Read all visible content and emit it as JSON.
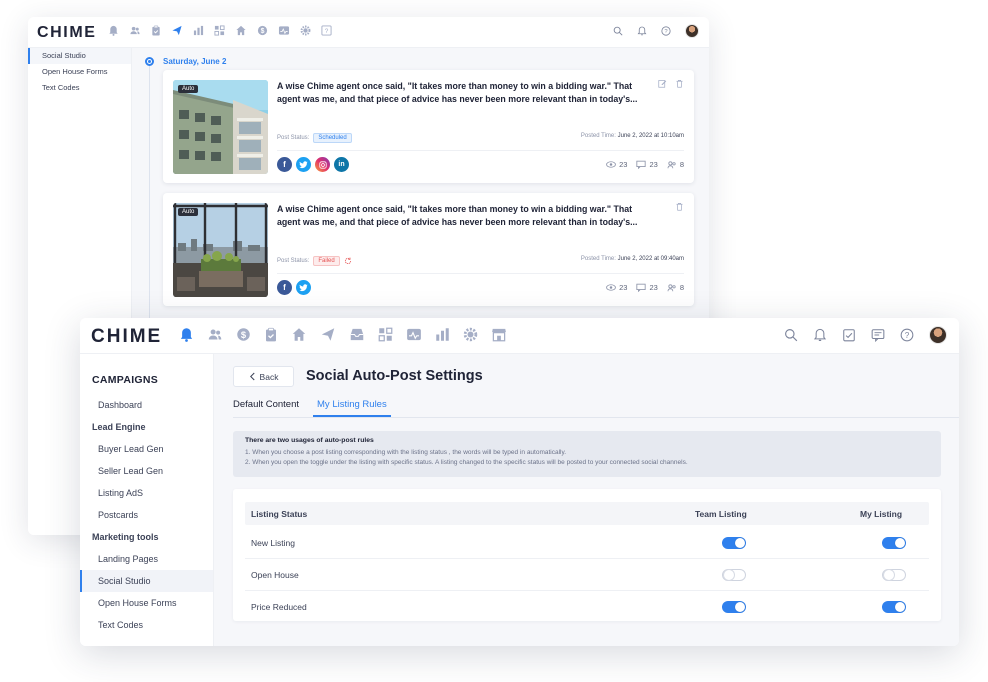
{
  "window1": {
    "logo": "CHIME",
    "sidebar_items": [
      {
        "label": "Social Studio",
        "active": true
      },
      {
        "label": "Open House Forms",
        "active": false
      },
      {
        "label": "Text Codes",
        "active": false
      }
    ],
    "timeline_date": "Saturday, June 2",
    "posts": [
      {
        "badge": "Auto",
        "text": "A wise Chime agent once said, \"It takes more than money to win a bidding war.\" That agent was me, and that piece of advice has never been more relevant than in today's...",
        "status_label": "Post Status:",
        "status": "Scheduled",
        "time_label": "Posted Time:",
        "time": "June 2, 2022 at 10:10am",
        "views": "23",
        "comments": "23",
        "reach": "8"
      },
      {
        "badge": "Auto",
        "text": "A wise Chime agent once said, \"It takes more than money to win a bidding war.\" That agent was me, and that piece of advice has never been more relevant than in today's...",
        "status_label": "Post Status:",
        "status": "Failed",
        "time_label": "Posted Time:",
        "time": "June 2, 2022 at 09:40am",
        "views": "23",
        "comments": "23",
        "reach": "8"
      }
    ],
    "social": {
      "facebook": "f",
      "twitter": "t",
      "instagram": "o",
      "linkedin": "in"
    }
  },
  "window2": {
    "logo": "CHIME",
    "sidebar": {
      "heading": "CAMPAIGNS",
      "items": [
        {
          "label": "Dashboard",
          "type": "item"
        },
        {
          "label": "Lead Engine",
          "type": "section"
        },
        {
          "label": "Buyer Lead Gen",
          "type": "item"
        },
        {
          "label": "Seller Lead Gen",
          "type": "item"
        },
        {
          "label": "Listing AdS",
          "type": "item"
        },
        {
          "label": "Postcards",
          "type": "item"
        },
        {
          "label": "Marketing tools",
          "type": "section"
        },
        {
          "label": "Landing Pages",
          "type": "item"
        },
        {
          "label": "Social Studio",
          "type": "item",
          "active": true
        },
        {
          "label": "Open House Forms",
          "type": "item"
        },
        {
          "label": "Text Codes",
          "type": "item"
        }
      ]
    },
    "back_label": "Back",
    "page_title": "Social Auto-Post Settings",
    "tabs": [
      {
        "label": "Default Content",
        "active": false
      },
      {
        "label": "My Listing Rules",
        "active": true
      }
    ],
    "info": {
      "title": "There are two usages of auto-post rules",
      "line1": "1. When you choose a post listing corresponding with the listing status , the words will be typed in automatically.",
      "line2": "2. When you open the toggle under the listing with specific status. A listing changed to the specific status will be posted to your connected social channels."
    },
    "table": {
      "headers": {
        "status": "Listing Status",
        "team": "Team Listing",
        "mine": "My Listing"
      },
      "rows": [
        {
          "label": "New Listing",
          "team": true,
          "mine": true
        },
        {
          "label": "Open House",
          "team": false,
          "mine": false
        },
        {
          "label": "Price Reduced",
          "team": true,
          "mine": true
        }
      ]
    }
  },
  "colors": {
    "accent": "#2f80ed",
    "failed": "#e55353",
    "text": "#202437"
  }
}
